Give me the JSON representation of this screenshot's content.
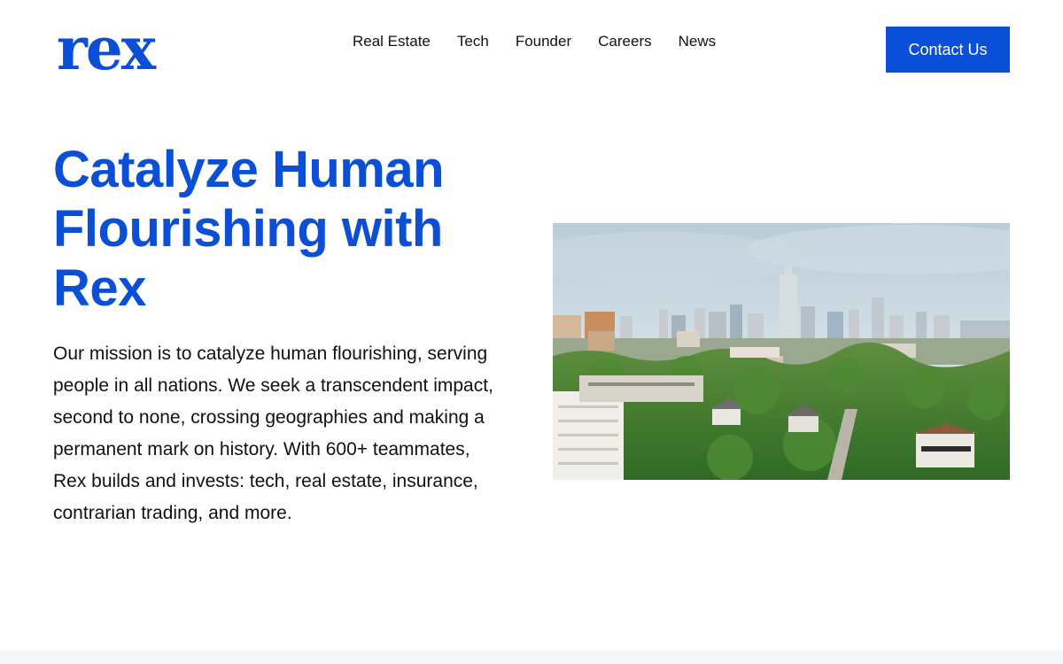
{
  "brand": {
    "logo_text": "rex",
    "brand_color": "#0a4fd6"
  },
  "nav": {
    "items": [
      {
        "label": "Real Estate"
      },
      {
        "label": "Tech"
      },
      {
        "label": "Founder"
      },
      {
        "label": "Careers"
      },
      {
        "label": "News"
      }
    ],
    "contact_label": "Contact Us"
  },
  "hero": {
    "title": "Catalyze Human Flourishing with Rex",
    "text": "Our mission is to catalyze human flourishing, serving people in all nations. We seek a transcendent impact, second to none, crossing geographies and making a permanent mark on history. With 600+ teammates, Rex builds and invests: tech, real estate, insurance, contrarian trading, and more."
  }
}
